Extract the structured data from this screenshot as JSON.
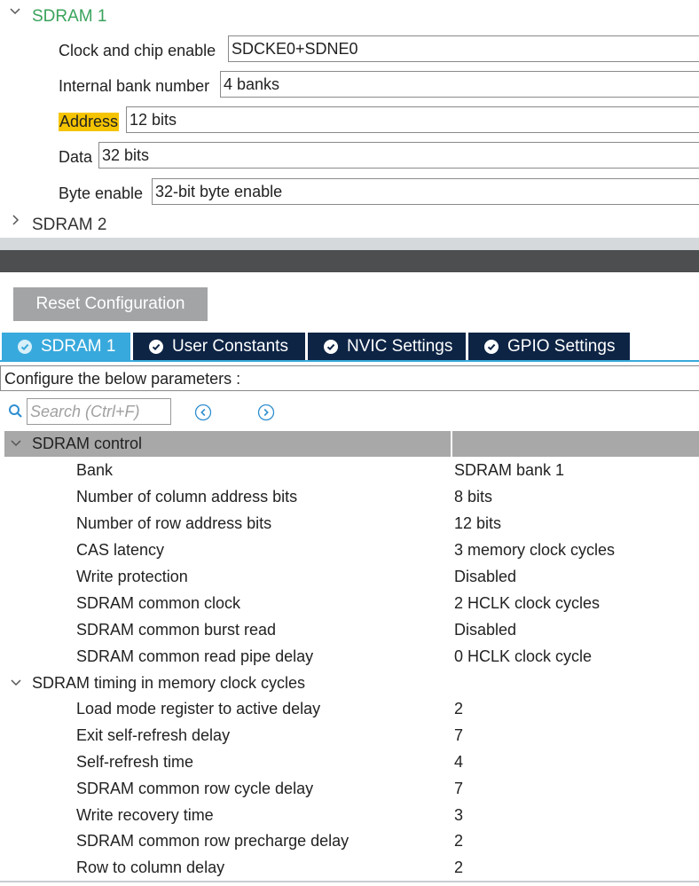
{
  "tree": {
    "sdram1": {
      "title": "SDRAM 1",
      "params": [
        {
          "label": "Clock and chip enable",
          "value": "SDCKE0+SDNE0"
        },
        {
          "label": "Internal bank number",
          "value": "4 banks"
        },
        {
          "label": "Address",
          "value": "12 bits",
          "highlighted": true
        },
        {
          "label": "Data",
          "value": "32 bits"
        },
        {
          "label": "Byte enable",
          "value": "32-bit byte enable"
        }
      ]
    },
    "sdram2": {
      "title": "SDRAM 2"
    }
  },
  "reset_button": "Reset Configuration",
  "tabs": [
    {
      "label": "SDRAM 1",
      "active": true
    },
    {
      "label": "User Constants",
      "active": false
    },
    {
      "label": "NVIC Settings",
      "active": false
    },
    {
      "label": "GPIO Settings",
      "active": false
    }
  ],
  "configure_text": "Configure the below parameters :",
  "search": {
    "placeholder": "Search (Ctrl+F)"
  },
  "groups": [
    {
      "title": "SDRAM control",
      "params": [
        {
          "name": "Bank",
          "value": "SDRAM bank 1"
        },
        {
          "name": "Number of column address bits",
          "value": "8 bits"
        },
        {
          "name": "Number of row address bits",
          "value": "12 bits"
        },
        {
          "name": "CAS latency",
          "value": "3 memory clock cycles"
        },
        {
          "name": "Write protection",
          "value": "Disabled"
        },
        {
          "name": "SDRAM common clock",
          "value": "2 HCLK clock cycles"
        },
        {
          "name": "SDRAM common burst read",
          "value": "Disabled"
        },
        {
          "name": "SDRAM common read pipe delay",
          "value": "0 HCLK clock cycle"
        }
      ]
    },
    {
      "title": "SDRAM timing in memory clock cycles",
      "params": [
        {
          "name": "Load mode register to active delay",
          "value": "2"
        },
        {
          "name": "Exit self-refresh delay",
          "value": "7"
        },
        {
          "name": "Self-refresh time",
          "value": "4"
        },
        {
          "name": "SDRAM common row cycle delay",
          "value": "7"
        },
        {
          "name": "Write recovery time",
          "value": "3"
        },
        {
          "name": "SDRAM common row precharge delay",
          "value": "2"
        },
        {
          "name": "Row to column delay",
          "value": "2"
        }
      ]
    }
  ],
  "colors": {
    "tree_active_title": "#3aa35c",
    "highlight": "#f5c400",
    "tab_active": "#38a9dc",
    "tab_inactive": "#0d2445",
    "group_header": "#a8a8a8",
    "reset_button": "#a2a4a6"
  },
  "icons": {
    "tree_expanded": "chevron-down-icon",
    "tree_collapsed": "chevron-right-icon",
    "tab": "check-circle-icon",
    "search": "search-icon",
    "nav_prev": "previous-circle-icon",
    "nav_next": "next-circle-icon"
  }
}
